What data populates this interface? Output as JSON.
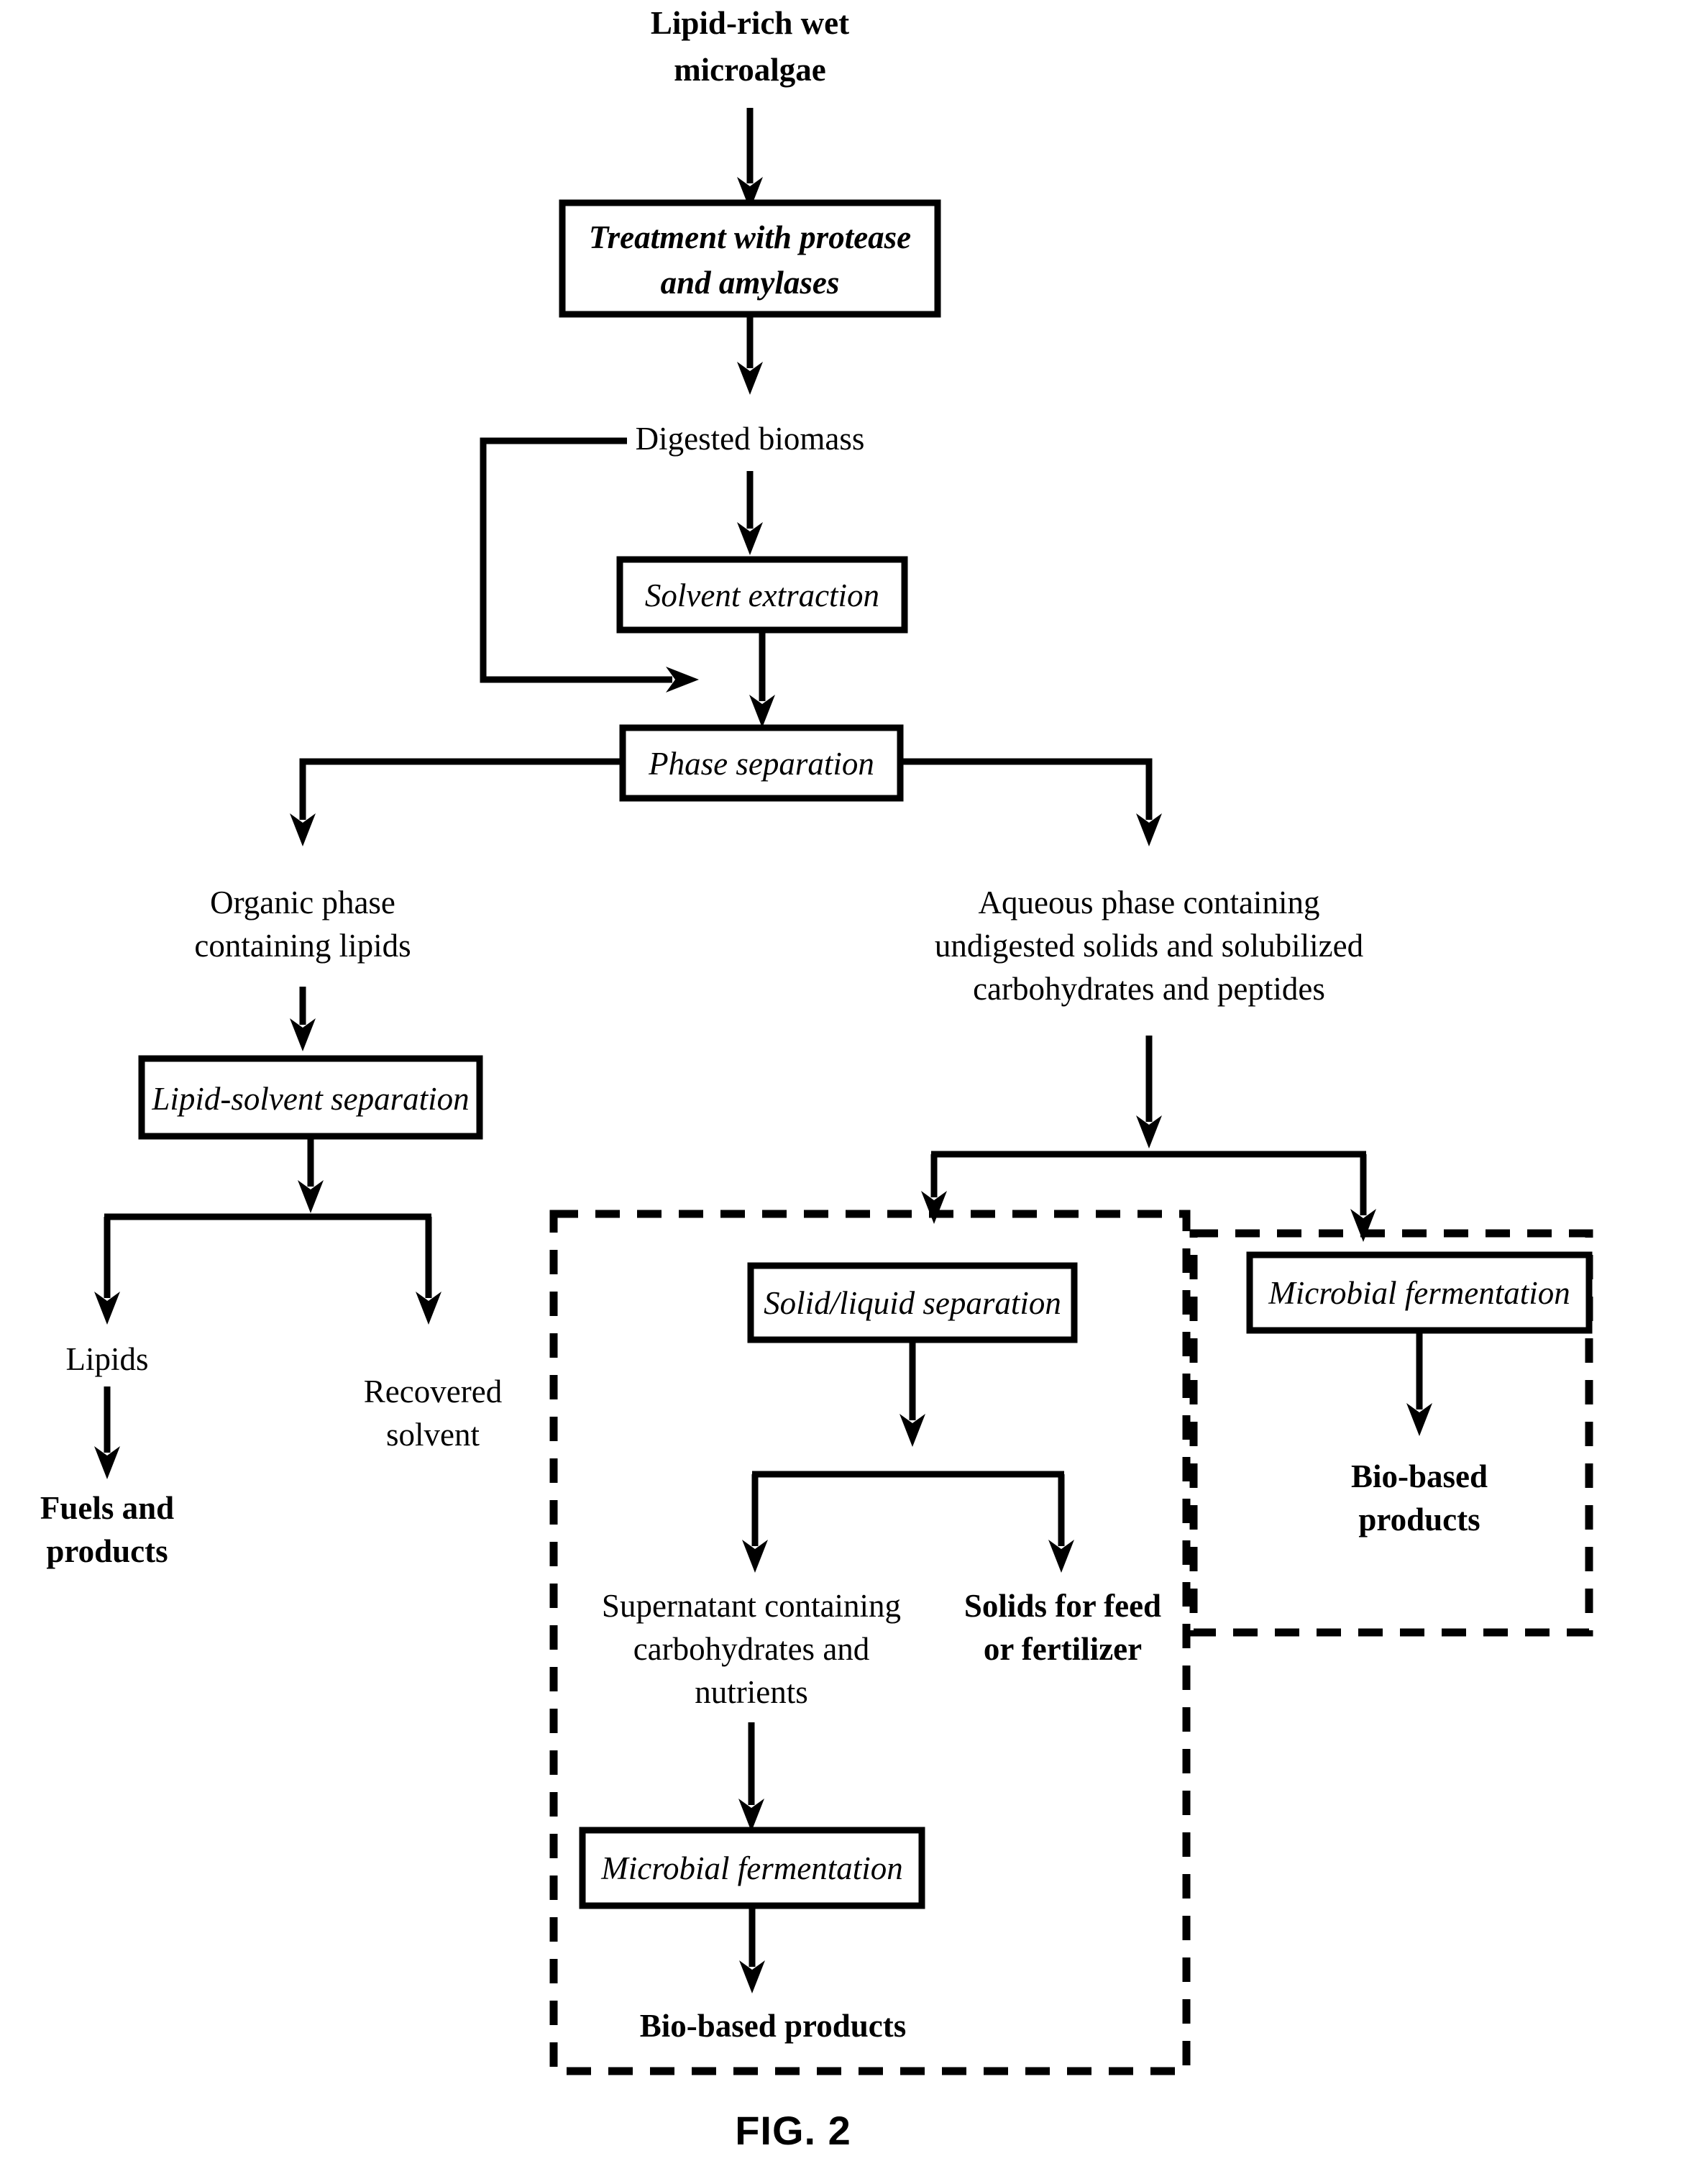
{
  "figure": {
    "caption": "FIG. 2",
    "type": "process-flow-diagram"
  },
  "nodes": {
    "input_label": {
      "line1": "Lipid-rich wet",
      "line2": "microalgae"
    },
    "treatment_box": {
      "line1": "Treatment with protease",
      "line2": "and amylases"
    },
    "digested_biomass": "Digested biomass",
    "solvent_extraction": "Solvent extraction",
    "phase_separation": "Phase separation",
    "organic_phase": {
      "line1": "Organic phase",
      "line2": "containing lipids"
    },
    "aqueous_phase": {
      "line1": "Aqueous phase containing",
      "line2": "undigested solids and solubilized",
      "line3": "carbohydrates and peptides"
    },
    "lipid_solvent_separation": "Lipid-solvent separation",
    "lipids": "Lipids",
    "recovered_solvent": {
      "line1": "Recovered",
      "line2": "solvent"
    },
    "fuels_and_products": {
      "line1": "Fuels and",
      "line2": "products"
    },
    "solid_liquid_separation": "Solid/liquid separation",
    "supernatant": {
      "line1": "Supernatant containing",
      "line2": "carbohydrates and",
      "line3": "nutrients"
    },
    "solids_for_feed": {
      "line1": "Solids for feed",
      "line2": "or fertilizer"
    },
    "microbial_fermentation_center": "Microbial fermentation",
    "bio_based_products_center": "Bio-based products",
    "microbial_fermentation_right": "Microbial fermentation",
    "bio_based_products_right": {
      "line1": "Bio-based",
      "line2": "products"
    }
  },
  "colors": {
    "stroke": "#000000",
    "fill": "#ffffff",
    "background": "#ffffff"
  }
}
